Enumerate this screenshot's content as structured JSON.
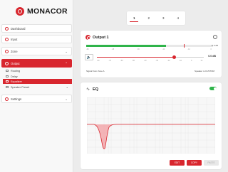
{
  "brand": {
    "name": "MONACOR",
    "accent": "#d8262e"
  },
  "sidebar": {
    "items": [
      {
        "label": "Dashboard",
        "icon": "dashboard-icon"
      },
      {
        "label": "Input",
        "icon": "input-icon"
      },
      {
        "label": "Zone",
        "icon": "zone-icon"
      },
      {
        "label": "Output",
        "icon": "output-icon",
        "active": true
      },
      {
        "label": "Settings",
        "icon": "settings-icon"
      }
    ],
    "sub_items": [
      {
        "label": "Routing",
        "icon": "routing-icon"
      },
      {
        "label": "Delay",
        "icon": "delay-icon"
      },
      {
        "label": "Equalizer",
        "icon": "equalizer-icon",
        "active": true
      },
      {
        "label": "Speaker Preset",
        "icon": "speaker-preset-icon"
      }
    ]
  },
  "tabs": [
    "1",
    "2",
    "3",
    "4"
  ],
  "output": {
    "title": "Output 1",
    "meter_scale": [
      "-60",
      "-48",
      "-36",
      "-24",
      "-12",
      "0"
    ],
    "meter_value": "-6.0 dB",
    "volume_scale": [
      "-80",
      "-70",
      "-60",
      "-50",
      "-40",
      "-30",
      "-20",
      "-10",
      "0",
      "10"
    ],
    "volume_value": "0.0 dB",
    "meter_level_pct": 63,
    "volume_level_pct": 72,
    "footer_left": "Signal from Zone A",
    "footer_right": "Speaker is CUSTOM"
  },
  "eq": {
    "title": "EQ",
    "enabled": true,
    "buttons": [
      "EDIT",
      "COPY",
      "PASTE"
    ]
  }
}
